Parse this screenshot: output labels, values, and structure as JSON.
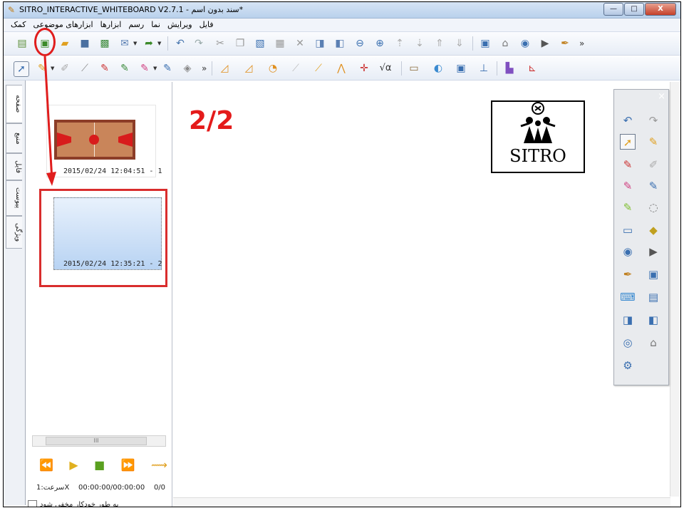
{
  "window": {
    "title": "SITRO_INTERACTIVE_WHITEBOARD V2.7.1 - سند بدون اسم*",
    "controls": {
      "minimize": "—",
      "maximize": "□",
      "close": "X"
    }
  },
  "menu": {
    "items": [
      "کمک",
      "ابزارهای موضوعی",
      "ابزارها",
      "رسم",
      "نما",
      "ویرایش",
      "فایل"
    ]
  },
  "toolbar_main": {
    "overflow": "»",
    "icons": [
      "new-document",
      "new-page",
      "open-folder",
      "save",
      "add-image",
      "email",
      "export",
      "undo",
      "redo",
      "cut",
      "copy",
      "paste",
      "paste-special",
      "delete",
      "clone",
      "lock",
      "zoom-out",
      "zoom-in",
      "move-up",
      "move-down",
      "send-to-back",
      "bring-to-front",
      "screen-capture",
      "mouse-mode",
      "camera",
      "video",
      "highlighter"
    ]
  },
  "toolbar_draw": {
    "overflow": "»",
    "formula": "√α",
    "icons": [
      "select-arrow",
      "pen",
      "eraser",
      "stroke",
      "brush",
      "marker",
      "crayon",
      "pencil",
      "fill",
      "triangle",
      "triangle-2",
      "protractor",
      "compass-pen",
      "ruler-pen",
      "compass",
      "axis",
      "formula",
      "graph",
      "test-tube",
      "chart",
      "balance",
      "blocks",
      "coordinate-chart"
    ]
  },
  "side_tabs": [
    "صفحه",
    "منبع",
    "فایل",
    "پیوست",
    "ویژگی"
  ],
  "pages_panel": {
    "thumbnails": [
      {
        "label": "2015/02/24 12:04:51 - 1",
        "content": "basketball-court"
      },
      {
        "label": "2015/02/24 12:35:21 - 2",
        "content": "blank"
      }
    ],
    "scroll_grip": "III",
    "playback": {
      "speed_label": "سرعت:1X",
      "time": "00:00:00/00:00:00",
      "count": "0/0"
    },
    "auto_hide_label": "به طور خودکار مخفی شود"
  },
  "canvas": {
    "page_counter": "2/2",
    "logo_text": "SITRO"
  },
  "float_tools": {
    "close": "×",
    "icons": [
      "undo",
      "redo",
      "select",
      "pen",
      "brush",
      "eraser",
      "marker",
      "pencil",
      "highlighter",
      "lasso",
      "rectangle",
      "3d-shape",
      "camera",
      "video",
      "magic-pen",
      "screen",
      "keyboard",
      "screen-tools",
      "page",
      "pages",
      "webcam",
      "mouse",
      "settings"
    ]
  },
  "colors": {
    "annotation_red": "#e01d1d",
    "page_counter_red": "#e41b1b"
  }
}
